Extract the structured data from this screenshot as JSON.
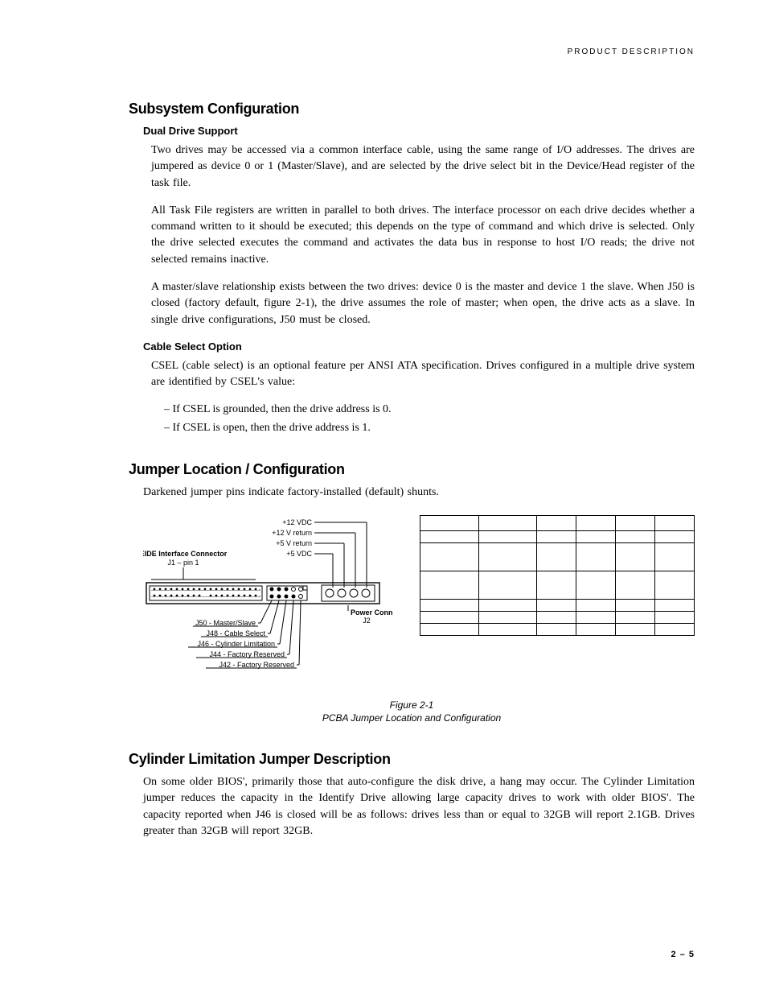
{
  "running_head": "PRODUCT DESCRIPTION",
  "section1": {
    "title": "Subsystem Configuration",
    "sub1": {
      "title": "Dual Drive Support",
      "p1": "Two drives may be accessed via a common interface cable, using the same range of I/O addresses. The drives are jumpered as device 0 or 1 (Master/Slave), and are selected by the drive select bit in the Device/Head register of the task file.",
      "p2": "All Task File registers are written in parallel to both drives. The interface processor on each drive decides whether a command written to it should be executed; this depends on the type of command and which drive is selected. Only the drive selected executes the command and activates the data bus in response to host I/O reads; the drive not selected remains inactive.",
      "p3": "A master/slave relationship exists between the two drives: device 0 is the master and device 1 the slave. When J50 is closed (factory default, figure 2-1), the drive assumes the role of master; when open, the drive acts as a slave. In single drive configurations, J50 must be closed."
    },
    "sub2": {
      "title": "Cable Select Option",
      "p1": "CSEL (cable select) is an optional feature per ANSI ATA specification. Drives configured in a multiple drive system are identified by CSEL's value:",
      "b1": "– If CSEL is grounded, then the drive address is 0.",
      "b2": "– If CSEL is open, then the drive address is 1."
    }
  },
  "section2": {
    "title": "Jumper Location / Configuration",
    "p1": "Darkened jumper pins indicate factory-installed (default) shunts."
  },
  "figure": {
    "caption_line1": "Figure 2-1",
    "caption_line2": "PCBA Jumper Location and Configuration",
    "labels": {
      "twelve_vdc": "+12 VDC",
      "twelve_ret": "+12 V return",
      "five_ret": "+5 V return",
      "five_vdc": "+5 VDC",
      "eide": "EIDE Interface Connector",
      "j1pin1": "J1 – pin 1",
      "power_conn": "Power Connector",
      "j2": "J2",
      "j50": "J50 - Master/Slave",
      "j48": "J48 - Cable Select",
      "j46": "J46 - Cylinder Limitation",
      "j44": "J44 - Factory Reserved",
      "j42": "J42 - Factory Reserved"
    }
  },
  "section3": {
    "title": "Cylinder Limitation Jumper Description",
    "p1": "On some older BIOS', primarily those that auto-configure the disk drive, a hang may occur. The Cylinder Limitation jumper reduces the capacity in the Identify Drive allowing large capacity drives to work with older BIOS'. The capacity reported when J46 is closed will be as follows: drives less than or equal to 32GB will report 2.1GB. Drives greater than 32GB will report 32GB."
  },
  "page_number": "2 – 5"
}
